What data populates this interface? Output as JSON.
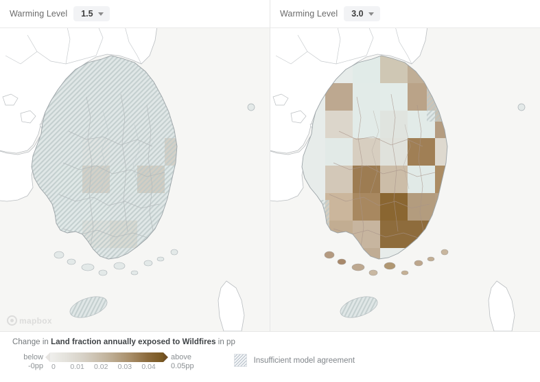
{
  "panels": [
    {
      "id": "panel-warming-1p5",
      "control_label": "Warming Level",
      "value": "1.5",
      "attribution": "mapbox"
    },
    {
      "id": "panel-warming-3p0",
      "control_label": "Warming Level",
      "value": "3.0",
      "attribution": "mapbox"
    }
  ],
  "legend": {
    "title_prefix": "Change in ",
    "title_variable": "Land fraction annually exposed to Wildfires",
    "title_suffix": " in pp",
    "below_label": "below\n-0pp",
    "below_line1": "below",
    "below_line2": "-0pp",
    "above_line1": "above",
    "above_line2": "0.05pp",
    "ticks": [
      "0",
      "0.01",
      "0.02",
      "0.03",
      "0.04"
    ],
    "tick_values": [
      0,
      0.01,
      0.02,
      0.03,
      0.04
    ],
    "vmin": 0,
    "vmax": 0.05,
    "colors": {
      "low": "#efefec",
      "mid": "#c2b49d",
      "high": "#77561f",
      "hatch_fill": "#eceef0",
      "hatch_line": "#c6ced6",
      "land": "#ffffff",
      "sea": "#f6f6f4",
      "border": "#b8bcbf"
    },
    "hatch_label": "Insufficient model agreement"
  },
  "chart_data": {
    "type": "heatmap",
    "title": "Change in Land fraction annually exposed to Wildfires in pp",
    "xlabel": "",
    "ylabel": "",
    "units": "pp",
    "colorbar_range": [
      0,
      0.05
    ],
    "colorbar_ticks": [
      0,
      0.01,
      0.02,
      0.03,
      0.04
    ],
    "below_range_label": "below -0pp",
    "above_range_label": "above 0.05pp",
    "region": "Korean Peninsula",
    "maps": [
      {
        "name": "Warming Level 1.5",
        "warming_level": 1.5,
        "cell_size_px": 40,
        "hatched_everywhere": true,
        "cells": [
          {
            "col": 3,
            "row": 3,
            "value": 0.004,
            "hex": "#e4e5e1"
          },
          {
            "col": 4,
            "row": 3,
            "value": 0.026,
            "hex": "#c7b8a4"
          },
          {
            "col": 5,
            "row": 3,
            "value": 0.001,
            "hex": "#e2ebe8"
          },
          {
            "col": 6,
            "row": 3,
            "value": 0.028,
            "hex": "#c3b29b"
          },
          {
            "col": 3,
            "row": 4,
            "value": 0.001,
            "hex": "#e3ecea"
          },
          {
            "col": 4,
            "row": 4,
            "value": 0.0005,
            "hex": "#e3ecea"
          },
          {
            "col": 6,
            "row": 4,
            "value": 0.002,
            "hex": "#e4ece9"
          },
          {
            "col": 3,
            "row": 5,
            "value": 0.0005,
            "hex": "#e5eeeb"
          },
          {
            "col": 4,
            "row": 5,
            "value": 0.01,
            "hex": "#dedbd3"
          },
          {
            "col": 5,
            "row": 5,
            "value": 0.02,
            "hex": "#cfc7b6"
          },
          {
            "col": 6,
            "row": 5,
            "value": 0.023,
            "hex": "#cabfaa"
          },
          {
            "col": 2,
            "row": 2,
            "value": 0.002,
            "hex": "#e5edea"
          }
        ]
      },
      {
        "name": "Warming Level 3.0",
        "warming_level": 3.0,
        "cell_size_px": 40,
        "hatched_everywhere": false,
        "cells": [
          {
            "col": 2,
            "row": 1,
            "value": 0.002,
            "hex": "#e1ebe8"
          },
          {
            "col": 3,
            "row": 1,
            "value": 0.018,
            "hex": "#cfc7b4"
          },
          {
            "col": 4,
            "row": 1,
            "value": 0.026,
            "hex": "#c0ae96"
          },
          {
            "col": 1,
            "row": 2,
            "value": 0.026,
            "hex": "#bda890"
          },
          {
            "col": 2,
            "row": 2,
            "value": 0.001,
            "hex": "#e2ebe8"
          },
          {
            "col": 3,
            "row": 2,
            "value": 0.002,
            "hex": "#e3ece9"
          },
          {
            "col": 4,
            "row": 2,
            "value": 0.029,
            "hex": "#baa388"
          },
          {
            "col": 5,
            "row": 2,
            "value": 0.029,
            "hex": "#bca78d"
          },
          {
            "col": 1,
            "row": 3,
            "value": 0.012,
            "hex": "#dcd6cb"
          },
          {
            "col": 2,
            "row": 3,
            "value": 0.001,
            "hex": "#e2ebe8"
          },
          {
            "col": 3,
            "row": 3,
            "value": 0.004,
            "hex": "#e0e4df"
          },
          {
            "col": 4,
            "row": 3,
            "value": 0.001,
            "hex": "#e2ebe8"
          },
          {
            "col": 5,
            "row": 3,
            "value": 0.03,
            "hex": "#b49c80"
          },
          {
            "col": 6,
            "row": 3,
            "value": 0.003,
            "hex": "#e1e9e5"
          },
          {
            "col": 1,
            "row": 4,
            "value": 0.002,
            "hex": "#e2eae7"
          },
          {
            "col": 2,
            "row": 4,
            "value": 0.014,
            "hex": "#d7cec0"
          },
          {
            "col": 3,
            "row": 4,
            "value": 0.006,
            "hex": "#e0e2dc"
          },
          {
            "col": 4,
            "row": 4,
            "value": 0.04,
            "hex": "#9a7murky"
          },
          {
            "col": 5,
            "row": 4,
            "value": 0.011,
            "hex": "#ded9cf"
          },
          {
            "col": 6,
            "row": 4,
            "value": 0.027,
            "hex": "#bfa98e"
          },
          {
            "col": 1,
            "row": 5,
            "value": 0.016,
            "hex": "#d3c8b8"
          },
          {
            "col": 2,
            "row": 5,
            "value": 0.038,
            "hex": "#9d7c52"
          },
          {
            "col": 3,
            "row": 5,
            "value": 0.021,
            "hex": "#ccbda8"
          },
          {
            "col": 4,
            "row": 5,
            "value": 0.002,
            "hex": "#e1eae7"
          },
          {
            "col": 5,
            "row": 5,
            "value": 0.033,
            "hex": "#ab8c63"
          },
          {
            "col": 1,
            "row": 6,
            "value": 0.034,
            "hex": "#a88860"
          },
          {
            "col": 2,
            "row": 6,
            "value": 0.047,
            "hex": "#8a6631"
          },
          {
            "col": 3,
            "row": 6,
            "value": 0.03,
            "hex": "#b39c7e"
          },
          {
            "col": 4,
            "row": 6,
            "value": 0.029,
            "hex": "#b59f82"
          },
          {
            "col": 5,
            "row": 6,
            "value": 0.036,
            "hex": "#a38355"
          }
        ]
      }
    ]
  }
}
